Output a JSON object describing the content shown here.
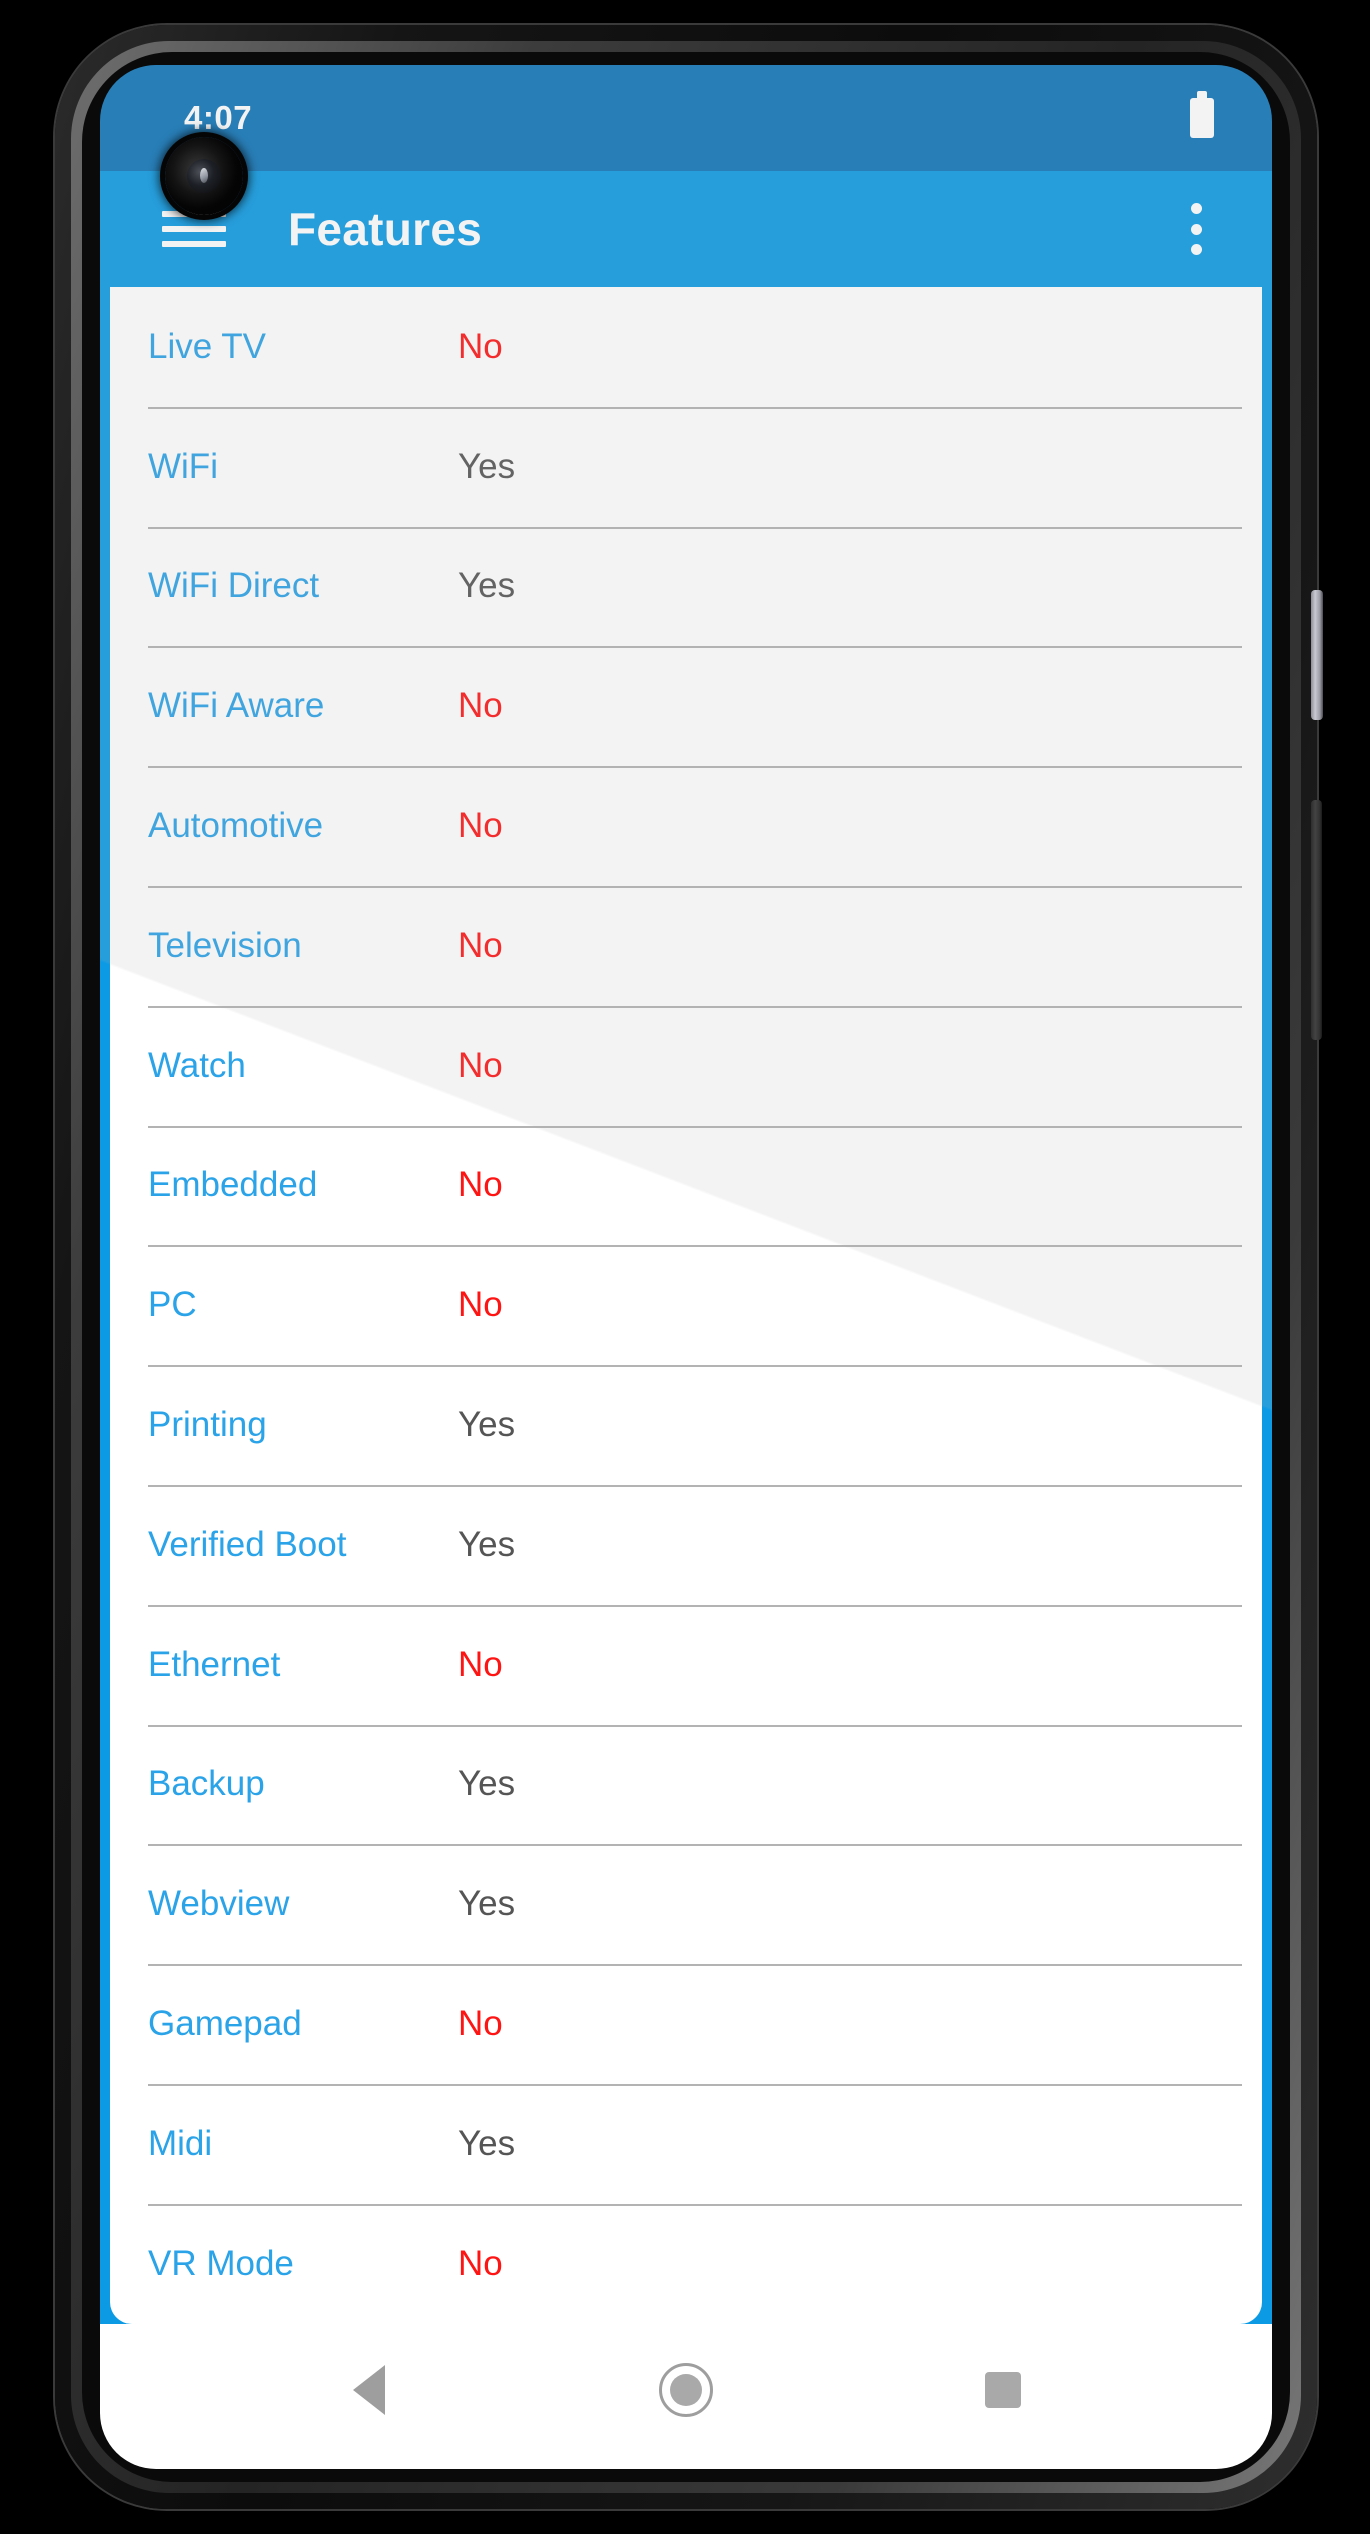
{
  "status_bar": {
    "time": "4:07",
    "battery_icon": "battery-full-icon"
  },
  "app_bar": {
    "title": "Features",
    "menu_icon": "hamburger-menu-icon",
    "overflow_icon": "overflow-menu-icon"
  },
  "colors": {
    "status_bar_bg": "#0f74b8",
    "app_bar_bg": "#0c9ae4",
    "label": "#2aa3e8",
    "value_yes": "#555555",
    "value_no": "#ff1414",
    "divider": "#b3b3b3",
    "card_bg": "#ffffff"
  },
  "feature_list": [
    {
      "label": "Live TV",
      "value": "No"
    },
    {
      "label": "WiFi",
      "value": "Yes"
    },
    {
      "label": "WiFi Direct",
      "value": "Yes"
    },
    {
      "label": "WiFi Aware",
      "value": "No"
    },
    {
      "label": "Automotive",
      "value": "No"
    },
    {
      "label": "Television",
      "value": "No"
    },
    {
      "label": "Watch",
      "value": "No"
    },
    {
      "label": "Embedded",
      "value": "No"
    },
    {
      "label": "PC",
      "value": "No"
    },
    {
      "label": "Printing",
      "value": "Yes"
    },
    {
      "label": "Verified Boot",
      "value": "Yes"
    },
    {
      "label": "Ethernet",
      "value": "No"
    },
    {
      "label": "Backup",
      "value": "Yes"
    },
    {
      "label": "Webview",
      "value": "Yes"
    },
    {
      "label": "Gamepad",
      "value": "No"
    },
    {
      "label": "Midi",
      "value": "Yes"
    },
    {
      "label": "VR Mode",
      "value": "No"
    }
  ],
  "nav_bar": {
    "back_icon": "triangle-back-icon",
    "home_icon": "circle-home-icon",
    "recents_icon": "square-recents-icon"
  }
}
